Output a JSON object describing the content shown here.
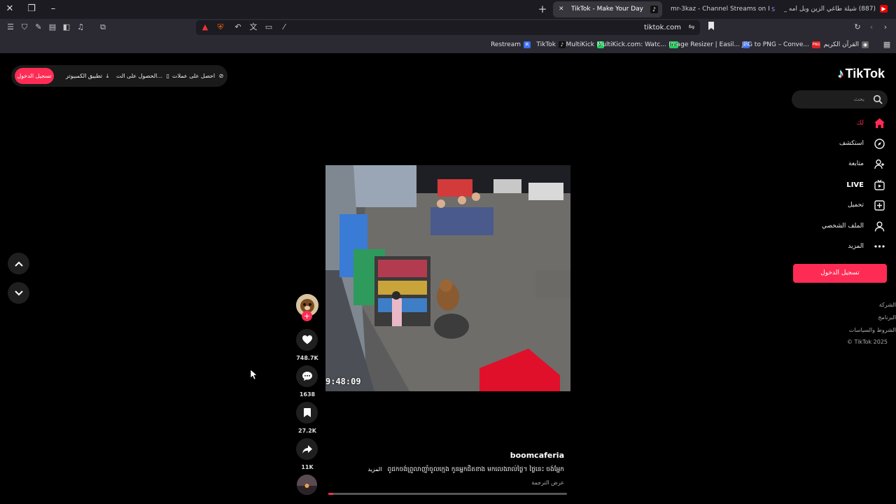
{
  "browser": {
    "tabs": [
      {
        "title": "TikTok - Make Your Day",
        "active": true
      },
      {
        "title": "mr-3kaz - Channel Streams on Kick",
        "active": false
      },
      {
        "title": "(887) شيلة طاغي الزين وبل امه _ اداء",
        "active": false
      }
    ],
    "url": "tiktok.com",
    "bookmarks": [
      {
        "label": "Restream",
        "icon": "R",
        "color": "#3a6df0"
      },
      {
        "label": "TikTok",
        "icon": "♪",
        "color": "#111111"
      },
      {
        "label": "MultiKick",
        "icon": "K",
        "color": "#1bd35a"
      },
      {
        "label": "MultiKick.com: Watc...",
        "icon": "MK",
        "color": "#1bd35a"
      },
      {
        "label": "Image Resizer | Easil...",
        "icon": "▭",
        "color": "#3a6df0"
      },
      {
        "label": "JPG to PNG – Conve...",
        "icon": "PNG",
        "color": "#d22"
      },
      {
        "label": "القرآن الكريم",
        "icon": "◉",
        "color": "#666666"
      }
    ]
  },
  "topbar": {
    "login": "تسجيل الدخول",
    "desktop_app": "تطبيق الكمبيوتر",
    "get_app": "الحصول على الت...",
    "get_coins": "احصل على عملات"
  },
  "logo": {
    "text": "TikTok"
  },
  "search": {
    "placeholder": "بحث"
  },
  "nav": [
    {
      "label": "لك",
      "icon": "home-icon",
      "active": true
    },
    {
      "label": "استكشف",
      "icon": "explore-icon",
      "active": false
    },
    {
      "label": "متابعة",
      "icon": "following-icon",
      "active": false
    },
    {
      "label": "LIVE",
      "icon": "live-icon",
      "active": false
    },
    {
      "label": "تحميل",
      "icon": "upload-icon",
      "active": false
    },
    {
      "label": "الملف الشخصي",
      "icon": "profile-icon",
      "active": false
    },
    {
      "label": "المزيد",
      "icon": "more-icon",
      "active": false
    }
  ],
  "sidebar_login": "تسجيل الدخول",
  "footer": {
    "company": "الشركة",
    "program": "البرنامج",
    "terms": "الشروط والسياسات",
    "copyright": "© TikTok 2025"
  },
  "video": {
    "timestamp": "9:48:09",
    "username": "boomcaferia",
    "caption": "ពូដកចង់ព្រួលាញ៉ាំចូលក្មេង កូនអ្នកជិតខាង មកលេងរាល់ថ្ងៃ។ ថ្ងៃនេះ ចង់អ្ហែក",
    "more": "المزيد",
    "translate": "عرض الترجمة",
    "progress": 0.02
  },
  "actions": {
    "likes": "748.7K",
    "comments": "1638",
    "saves": "27.2K",
    "shares": "11K"
  }
}
